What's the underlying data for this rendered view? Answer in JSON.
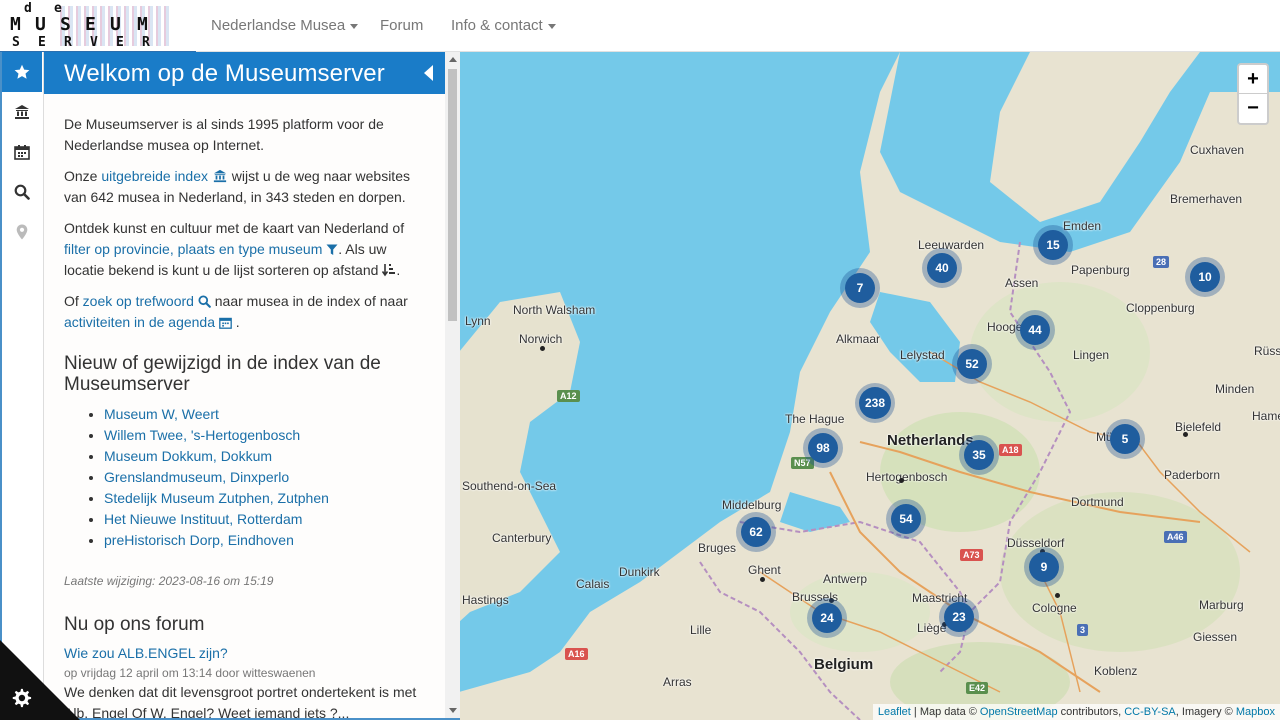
{
  "navbar": {
    "logo_letters": [
      "d",
      "e",
      "M",
      "U",
      "S",
      "E",
      "U",
      "M",
      "S",
      "E",
      "R",
      "V",
      "E",
      "R"
    ],
    "items": [
      {
        "label": "Nederlandse Musea",
        "dropdown": true
      },
      {
        "label": "Forum",
        "dropdown": false
      },
      {
        "label": "Info & contact",
        "dropdown": true
      }
    ]
  },
  "sidebar": {
    "tabs": [
      "star-icon",
      "museum-icon",
      "calendar-icon",
      "search-icon",
      "map-marker-icon"
    ],
    "title": "Welkom op de Museumserver",
    "intro": {
      "p1": "De Museumserver is al sinds 1995 platform voor de Nederlandse musea op Internet.",
      "p2_pre": "Onze ",
      "p2_link": "uitgebreide index",
      "p2_post": " wijst u de weg naar websites van 642 musea in Nederland, in 343 steden en dorpen.",
      "p3_pre": "Ontdek kunst en cultuur met de kaart van Nederland of ",
      "p3_link": "filter op provincie, plaats en type museum",
      "p3_post": ". Als uw locatie bekend is kunt u de lijst sorteren op afstand ",
      "p4_pre": "Of ",
      "p4_link1": "zoek op trefwoord",
      "p4_mid": " naar musea in de index of naar ",
      "p4_link2": "activiteiten in de agenda",
      "p4_post": "."
    },
    "new_heading": "Nieuw of gewijzigd in de index van de Museumserver",
    "new_items": [
      "Museum W, Weert",
      "Willem Twee, 's-Hertogenbosch",
      "Museum Dokkum, Dokkum",
      "Grenslandmuseum, Dinxperlo",
      "Stedelijk Museum Zutphen, Zutphen",
      "Het Nieuwe Instituut, Rotterdam",
      "preHistorisch Dorp, Eindhoven"
    ],
    "last_modified": "Laatste wijziging: 2023-08-16 om 15:19",
    "forum_heading": "Nu op ons forum",
    "forum_post": {
      "title": "Wie zou ALB.ENGEL zijn?",
      "meta": "op vrijdag 12 april om 13:14 door witteswaenen",
      "excerpt": "We denken dat dit levensgroot portret ondertekent is met Alb. Engel Of W. Engel? Weet iemand iets ?..."
    }
  },
  "map": {
    "zoom_in": "+",
    "zoom_out": "−",
    "clusters": [
      "15",
      "40",
      "7",
      "10",
      "44",
      "52",
      "238",
      "98",
      "35",
      "5",
      "54",
      "62",
      "9",
      "24",
      "23"
    ],
    "places": [
      "Emden",
      "Leeuwarden",
      "Papenburg",
      "Bremerhaven",
      "Cuxhaven",
      "Assen",
      "Cloppenburg",
      "Hoogeveen",
      "Lingen",
      "Alkmaar",
      "Lelystad",
      "Netherlands",
      "Münster",
      "Bielefeld",
      "The Hague",
      "Hertogenbosch",
      "Paderborn",
      "Dortmund",
      "Middelburg",
      "Düsseldorf",
      "Antwerp",
      "Bruges",
      "Ghent",
      "Calais",
      "Dunkirk",
      "Brussels",
      "Maastricht",
      "Cologne",
      "Marburg",
      "Liège",
      "Lille",
      "Giessen",
      "Belgium",
      "Koblenz",
      "Arras",
      "Norwich",
      "North Walsham",
      "Lynn",
      "Canterbury",
      "Southend-on-Sea",
      "Hastings",
      "Minden",
      "Hame",
      "Rüsse"
    ],
    "roads": [
      "A12",
      "N57",
      "A18",
      "A73",
      "A16",
      "E42",
      "A46",
      "3",
      "28"
    ]
  },
  "attribution": {
    "leaflet": "Leaflet",
    "sep1": " | Map data © ",
    "osm": "OpenStreetMap",
    "sep2": " contributors, ",
    "license": "CC-BY-SA",
    "sep3": ", Imagery © ",
    "mapbox": "Mapbox"
  },
  "colors": {
    "accent": "#1a7cc8",
    "link": "#1a6fa8",
    "cluster": "#1f5d9e",
    "sea": "#74c9e9",
    "land": "#e9e4d4"
  }
}
